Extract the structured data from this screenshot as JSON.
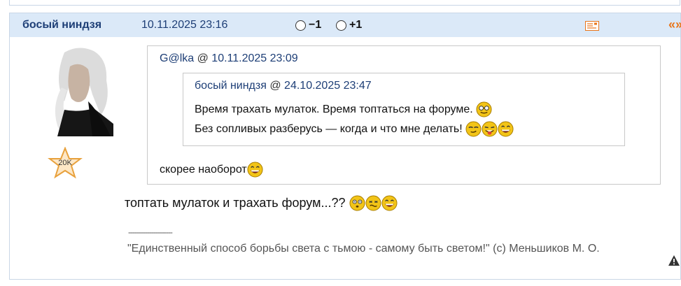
{
  "post": {
    "author": "босый ниндзя",
    "date": "10.11.2025 23:16",
    "vote_minus": "−1",
    "vote_plus": "+1",
    "quote_arrows": "«»",
    "rank": "20K",
    "quote": {
      "author": "G@lka",
      "at": "@",
      "date": "10.11.2025 23:09",
      "nested": {
        "author": "босый ниндзя",
        "at": "@",
        "date": "24.10.2025 23:47",
        "line1": "Время трахать мулаток. Время топтаться на форуме.",
        "line2": "Без сопливых разберусь — когда и что мне делать!"
      },
      "reply": "скорее наоборот"
    },
    "text": "топтать мулаток и трахать форум...??",
    "signature_separator": "---------------------",
    "signature": "\"Единственный способ борьбы света с тьмою - самому быть светом!\" (с) Меньшиков М. О."
  },
  "colors": {
    "header_bg": "#dbe9f8",
    "link": "#1d3e76",
    "accent": "#e8751a",
    "smiley": "#f2c417"
  }
}
